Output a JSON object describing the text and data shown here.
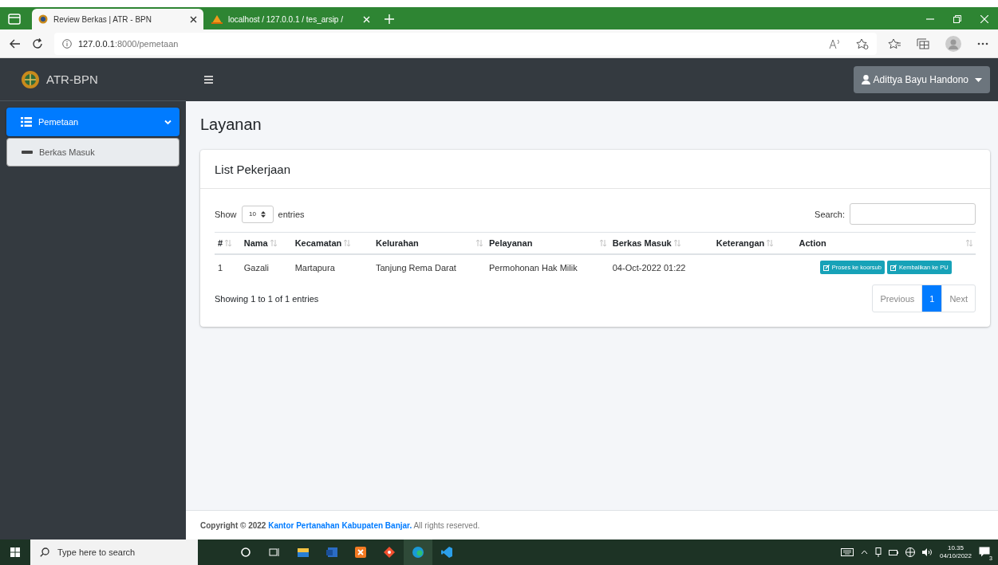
{
  "browser": {
    "tabs": [
      {
        "title": "Review Berkas | ATR - BPN",
        "selected": true
      },
      {
        "title": "localhost / 127.0.0.1 / tes_arsip /",
        "selected": false
      }
    ],
    "address": {
      "host": "127.0.0.1",
      "path": ":8000/pemetaan"
    }
  },
  "sidebar": {
    "brand": "ATR-BPN",
    "items": [
      {
        "label": "Pemetaan",
        "selected": true,
        "expanded": true,
        "children": [
          {
            "label": "Berkas Masuk",
            "selected": false
          }
        ]
      }
    ]
  },
  "navbar": {
    "user": "Adittya Bayu Handono"
  },
  "page": {
    "title": "Layanan"
  },
  "card": {
    "title": "List Pekerjaan",
    "show_label": "Show",
    "length_value": "10",
    "entries_label": "entries",
    "search_label": "Search:",
    "columns": [
      "#",
      "Nama",
      "Kecamatan",
      "Kelurahan",
      "Pelayanan",
      "Berkas Masuk",
      "Keterangan",
      "Action"
    ],
    "rows": [
      {
        "cells": [
          "1",
          "Gazali",
          "Martapura",
          "Tanjung Rema Darat",
          "Permohonan Hak Milik",
          "04-Oct-2022 01:22",
          ""
        ],
        "actions": [
          "Proses ke koorsub",
          "Kembalikan ke PU"
        ]
      }
    ],
    "info": "Showing 1 to 1 of 1 entries",
    "pagination": [
      {
        "label": "Previous",
        "selected": false,
        "disabled": true
      },
      {
        "label": "1",
        "selected": true,
        "disabled": false
      },
      {
        "label": "Next",
        "selected": false,
        "disabled": true
      }
    ]
  },
  "footer": {
    "prefix": "Copyright © 2022",
    "link": "Kantor Pertanahan Kabupaten Banjar.",
    "suffix": "All rights reserved."
  },
  "taskbar": {
    "search_placeholder": "Type here to search",
    "time": "10.35",
    "date": "04/10/2022",
    "notification_count": "3"
  }
}
